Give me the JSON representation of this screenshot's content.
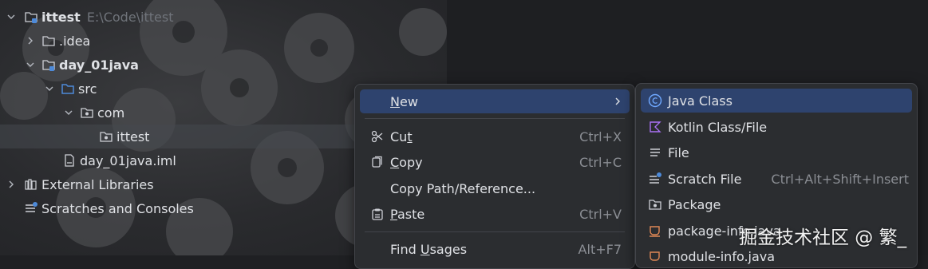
{
  "project_tree": {
    "root": {
      "name": "ittest",
      "path": "E:\\Code\\ittest"
    },
    "items": [
      {
        "label": "ittest"
      },
      {
        "label": ".idea"
      },
      {
        "label": "day_01java"
      },
      {
        "label": "src"
      },
      {
        "label": "com"
      },
      {
        "label": "ittest"
      },
      {
        "label": "day_01java.iml"
      },
      {
        "label": "External Libraries"
      },
      {
        "label": "Scratches and Consoles"
      }
    ]
  },
  "context_menu": {
    "items": [
      {
        "label_pre": "",
        "mnemonic": "N",
        "label_post": "ew",
        "shortcut": "",
        "has_submenu": true
      },
      {
        "label_pre": "Cu",
        "mnemonic": "t",
        "label_post": "",
        "shortcut": "Ctrl+X"
      },
      {
        "label_pre": "",
        "mnemonic": "C",
        "label_post": "opy",
        "shortcut": "Ctrl+C"
      },
      {
        "label_pre": "Copy Path/Reference...",
        "mnemonic": "",
        "label_post": "",
        "shortcut": ""
      },
      {
        "label_pre": "",
        "mnemonic": "P",
        "label_post": "aste",
        "shortcut": "Ctrl+V"
      },
      {
        "label_pre": "Find ",
        "mnemonic": "U",
        "label_post": "sages",
        "shortcut": "Alt+F7"
      }
    ]
  },
  "new_submenu": {
    "items": [
      {
        "label": "Java Class",
        "shortcut": ""
      },
      {
        "label": "Kotlin Class/File",
        "shortcut": ""
      },
      {
        "label": "File",
        "shortcut": ""
      },
      {
        "label": "Scratch File",
        "shortcut": "Ctrl+Alt+Shift+Insert"
      },
      {
        "label": "Package",
        "shortcut": ""
      },
      {
        "label": "package-info.java",
        "shortcut": ""
      },
      {
        "label": "module-info.java",
        "shortcut": ""
      }
    ]
  },
  "watermark": "掘金技术社区 @ 繁_",
  "colors": {
    "accent": "#2e436e",
    "menu_bg": "#2b2d30",
    "folder_blue": "#4d8ad9",
    "kotlin_purple": "#a971f4",
    "java_blue": "#6fa8ff",
    "orange": "#e08855"
  }
}
